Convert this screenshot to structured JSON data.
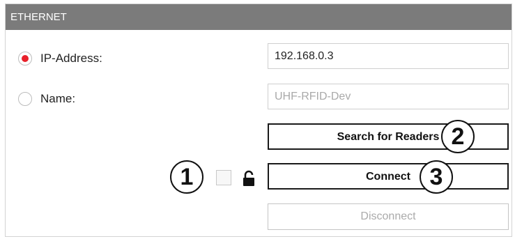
{
  "panel": {
    "title": "ETHERNET"
  },
  "connection_mode": {
    "selected": "ip",
    "ip_label": "IP-Address:",
    "name_label": "Name:"
  },
  "ip_address": {
    "value": "192.168.0.3"
  },
  "device_name": {
    "value": "UHF-RFID-Dev"
  },
  "buttons": {
    "search": "Search for Readers",
    "connect": "Connect",
    "disconnect": "Disconnect"
  },
  "callouts": {
    "one": "1",
    "two": "2",
    "three": "3"
  },
  "icons": {
    "lock": "unlocked-padlock-icon",
    "selected_radio": "radio-selected-icon"
  },
  "colors": {
    "header_bg": "#7b7b7b",
    "radio_selected": "#e8202a"
  }
}
